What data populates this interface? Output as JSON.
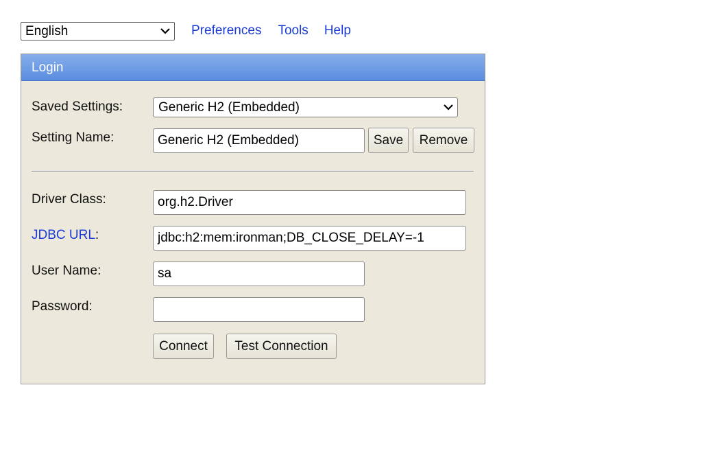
{
  "topbar": {
    "language": "English",
    "links": {
      "preferences": "Preferences",
      "tools": "Tools",
      "help": "Help"
    }
  },
  "login": {
    "title": "Login",
    "saved_settings": {
      "label": "Saved Settings:",
      "value": "Generic H2 (Embedded)"
    },
    "setting_name": {
      "label": "Setting Name:",
      "value": "Generic H2 (Embedded)",
      "save": "Save",
      "remove": "Remove"
    },
    "driver_class": {
      "label": "Driver Class:",
      "value": "org.h2.Driver"
    },
    "jdbc_url": {
      "label": "JDBC URL",
      "colon": ":",
      "value": "jdbc:h2:mem:ironman;DB_CLOSE_DELAY=-1"
    },
    "user_name": {
      "label": "User Name:",
      "value": "sa"
    },
    "password": {
      "label": "Password:",
      "value": ""
    },
    "buttons": {
      "connect": "Connect",
      "test": "Test Connection"
    }
  },
  "colors": {
    "link": "#1a3bd6",
    "panel_bg": "#ece9dc",
    "header_bg": "#6d9be4"
  }
}
